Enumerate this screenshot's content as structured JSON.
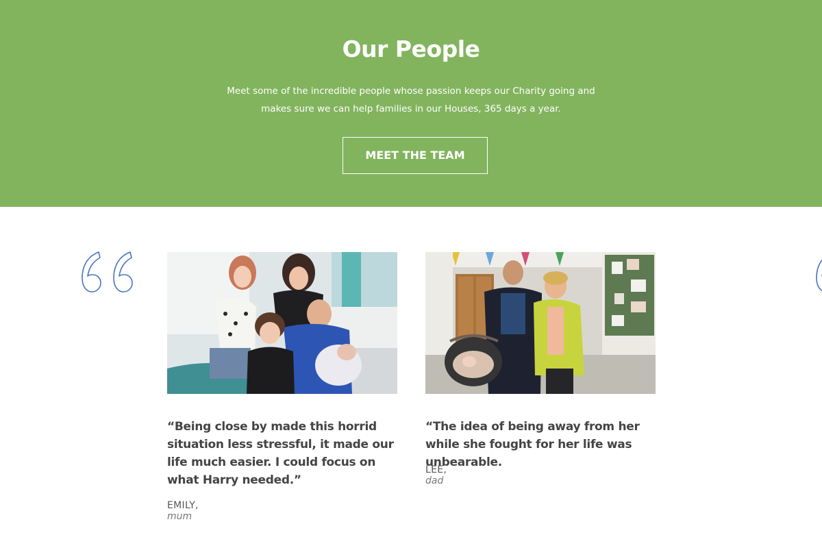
{
  "hero": {
    "title": "Our People",
    "description": "Meet some of the incredible people whose passion keeps our Charity going and makes sure we can help families in our Houses, 365 days a year.",
    "button_label": "MEET THE TEAM",
    "background_color": "#82b45e"
  },
  "testimonials": [
    {
      "photo": "family-hospital-photo",
      "quote": "“Being close by made this horrid situation less stressful, it made our life much easier. I could focus on what Harry needed.”",
      "name": "EMILY,",
      "role": "mum"
    },
    {
      "photo": "couple-with-pram-photo",
      "quote": "“The idea of being away from her while she fought for her life was unbearable.",
      "name": "LEE,",
      "role": "dad"
    }
  ],
  "icons": {
    "quote_mark": "quote-mark-icon",
    "quote_color": "#4a74c4"
  }
}
